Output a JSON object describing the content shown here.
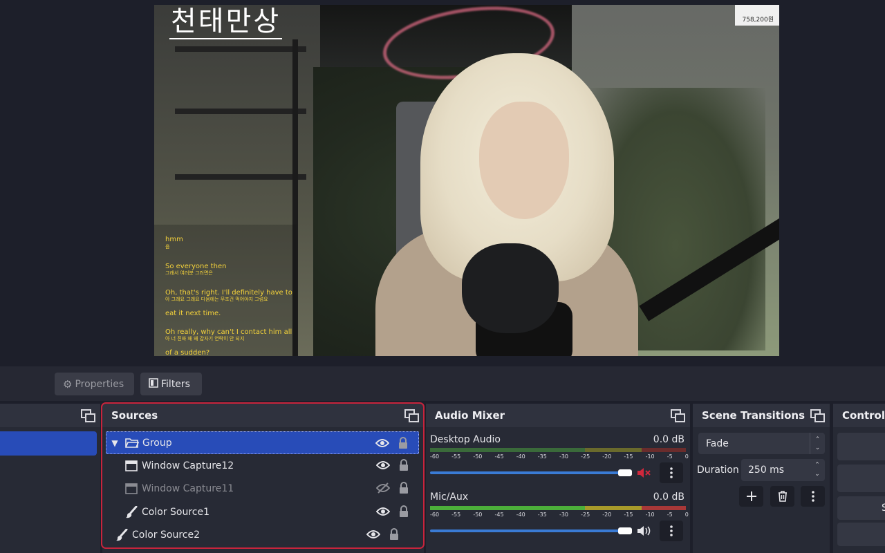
{
  "preview": {
    "overlay_title": "천태만상",
    "viewer_count": "758,200원",
    "subtitles": [
      {
        "text": "hmm",
        "small": false
      },
      {
        "text": "음",
        "small": true
      },
      {
        "text": "So everyone then",
        "small": false
      },
      {
        "text": "그래서 여러분 그러면은",
        "small": true
      },
      {
        "text": "Oh, that's right. I'll definitely have to",
        "small": false
      },
      {
        "text": "아 그래요 그래요 다음에는 무조건 먹어야지 그럼요",
        "small": true
      },
      {
        "text": "eat it next time.",
        "small": false
      },
      {
        "text": "Oh really, why can't I contact him all",
        "small": false
      },
      {
        "text": "아 너 진짜 왜 왜 갑자기 연락이 안 되지",
        "small": true
      },
      {
        "text": "of a sudden?",
        "small": false
      }
    ]
  },
  "toolbar": {
    "properties_label": "Properties",
    "filters_label": "Filters"
  },
  "scenes": {
    "title": ""
  },
  "sources": {
    "title": "Sources",
    "items": [
      {
        "name": "Group",
        "type": "group",
        "visible": true,
        "locked": true,
        "selected": true
      },
      {
        "name": "Window Capture12",
        "type": "window",
        "visible": true,
        "locked": true,
        "selected": false
      },
      {
        "name": "Window Capture11",
        "type": "window",
        "visible": false,
        "locked": true,
        "selected": false
      },
      {
        "name": "Color Source1",
        "type": "color",
        "visible": true,
        "locked": true,
        "selected": false
      },
      {
        "name": "Color Source2",
        "type": "color",
        "visible": true,
        "locked": true,
        "selected": false
      }
    ]
  },
  "audio": {
    "title": "Audio Mixer",
    "scale": [
      "-60",
      "-55",
      "-50",
      "-45",
      "-40",
      "-35",
      "-30",
      "-25",
      "-20",
      "-15",
      "-10",
      "-5",
      "0"
    ],
    "channels": [
      {
        "name": "Desktop Audio",
        "db": "0.0 dB",
        "muted": true,
        "volume_fraction": 1.0
      },
      {
        "name": "Mic/Aux",
        "db": "0.0 dB",
        "muted": false,
        "volume_fraction": 1.0
      }
    ]
  },
  "transitions": {
    "title": "Scene Transitions",
    "selected": "Fade",
    "duration_label": "Duration",
    "duration_value": "250 ms"
  },
  "controls": {
    "title": "Controls",
    "visible_button_text": "St"
  },
  "colors": {
    "accent": "#284cb8",
    "highlight_border": "#c8243c",
    "mute_red": "#d0283c",
    "subtitle_yellow": "#f5d33b"
  }
}
